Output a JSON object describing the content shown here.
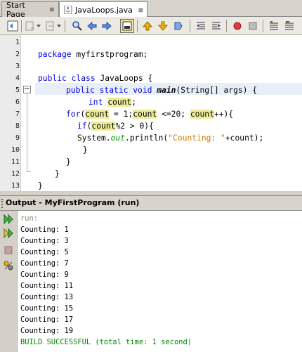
{
  "tabs": [
    {
      "label": "Start Page",
      "close": "⊠"
    },
    {
      "label": "JavaLoops.java",
      "close": "⊠"
    }
  ],
  "toolbar_icons": [
    "toggle-bookmark-icon",
    "back-icon",
    "forward-icon",
    "find-icon",
    "find-previous-icon",
    "find-next-icon",
    "toggle-highlight-icon",
    "previous-bookmark-icon",
    "next-bookmark-icon",
    "toggle-bookmarks-icon",
    "shift-left-icon",
    "shift-right-icon",
    "record-macro-icon",
    "stop-macro-icon",
    "comment-icon",
    "uncomment-icon"
  ],
  "editor": {
    "line_numbers": [
      "1",
      "2",
      "3",
      "4",
      "5",
      "6",
      "7",
      "8",
      "9",
      "10",
      "11",
      "12",
      "13"
    ],
    "fold_marker": "−"
  },
  "output": {
    "title": "Output - MyFirstProgram (run)",
    "lines": [
      "run:",
      "Counting: 1",
      "Counting: 3",
      "Counting: 5",
      "Counting: 7",
      "Counting: 9",
      "Counting: 11",
      "Counting: 13",
      "Counting: 15",
      "Counting: 17",
      "Counting: 19",
      "BUILD SUCCESSFUL (total time: 1 second)"
    ]
  },
  "code": {
    "l2a": "package",
    "l2b": " myfirstprogram;",
    "l4a": "public class",
    "l4b": " JavaLoops {",
    "l5a": "public static void",
    "l5b": "main",
    "l5c": "(String[] args) {",
    "l6a": "int",
    "l6b": "count",
    "l6c": ";",
    "l7a": "for",
    "l7b": "(",
    "l7c": "count",
    "l7d": " = 1;",
    "l7e": "count",
    "l7f": " <=20; ",
    "l7g": "count",
    "l7h": "++){",
    "l8a": "if",
    "l8b": "(",
    "l8c": "count",
    "l8d": "%2 > 0){",
    "l9a": "System.",
    "l9b": "out",
    "l9c": ".println(",
    "l9d": "\"Counting: \"",
    "l9e": "+count);",
    "l10": "}",
    "l11": "}",
    "l12": "}",
    "l13": "}"
  }
}
